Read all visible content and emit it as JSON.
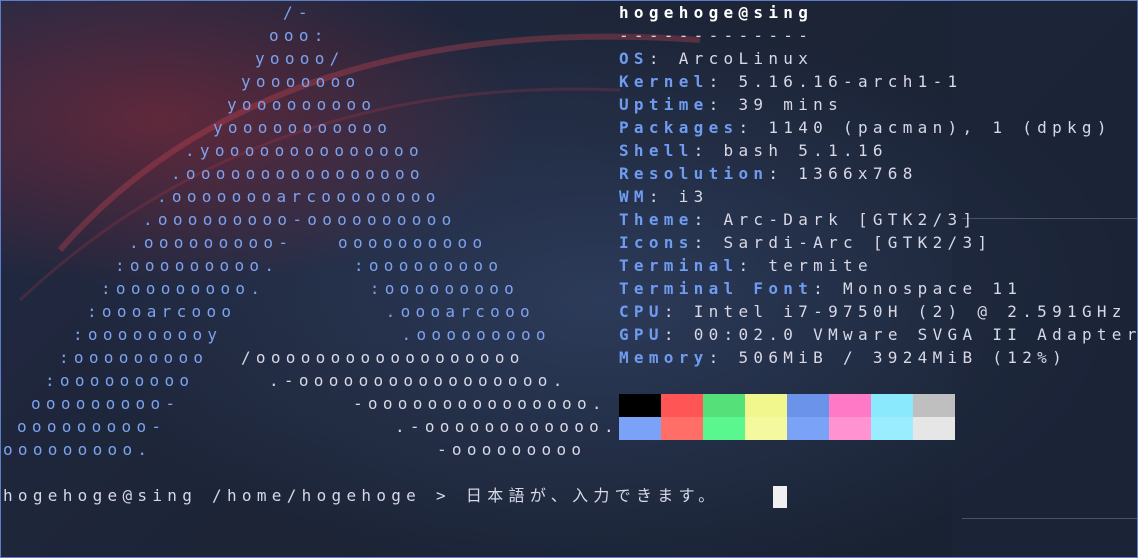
{
  "terminal": {
    "logo_lines": [
      "/-",
      "ooo:",
      "yoooo/",
      "yooooooo",
      "yooooooooo",
      "yooooooooooo",
      ".yoooooooooooooo",
      ".oooooooooooooooo",
      ".oooooooarcoooooooo",
      ".ooooooooo-oooooooooo",
      ".ooooooooo-   oooooooooo",
      ":ooooooooo.     :ooooooooo",
      ":ooooooooo.       :ooooooooo",
      ":oooarcooo          .oooarcooo",
      ":ooooooooy            .ooooooooo",
      ":ooooooooo    ",
      ":ooooooooo       ",
      "ooooooooo-            ",
      "ooooooooo-                  ",
      "ooooooooo.                       "
    ],
    "logo_white_parts": [
      "/oooooooooooooooooo",
      ".-ooooooooooooooooo.",
      "-ooooooooooooooo.",
      ".-oooooooooooo.",
      "-ooooooooo"
    ],
    "info": {
      "title": "hogehoge@sing",
      "separator": "-------------",
      "rows": [
        {
          "key": "OS",
          "value": "ArcoLinux"
        },
        {
          "key": "Kernel",
          "value": "5.16.16-arch1-1"
        },
        {
          "key": "Uptime",
          "value": "39 mins"
        },
        {
          "key": "Packages",
          "value": "1140 (pacman), 1 (dpkg)"
        },
        {
          "key": "Shell",
          "value": "bash 5.1.16"
        },
        {
          "key": "Resolution",
          "value": "1366x768"
        },
        {
          "key": "WM",
          "value": "i3"
        },
        {
          "key": "Theme",
          "value": "Arc-Dark [GTK2/3]"
        },
        {
          "key": "Icons",
          "value": "Sardi-Arc [GTK2/3]"
        },
        {
          "key": "Terminal",
          "value": "termite"
        },
        {
          "key": "Terminal Font",
          "value": "Monospace 11"
        },
        {
          "key": "CPU",
          "value": "Intel i7-9750H (2) @ 2.591GHz"
        },
        {
          "key": "GPU",
          "value": "00:02.0 VMware SVGA II Adapter"
        },
        {
          "key": "Memory",
          "value": "506MiB / 3924MiB (12%)"
        }
      ]
    },
    "palette": {
      "normal": [
        "#000000",
        "#ff5555",
        "#55e07a",
        "#f1f78c",
        "#6b93ea",
        "#ff79c6",
        "#8be9fd",
        "#bfbfbf"
      ],
      "bright": [
        "#7aa2f7",
        "#ff6e67",
        "#5af78e",
        "#f4f99d",
        "#7aa2f7",
        "#ff92d0",
        "#9aedfe",
        "#e6e6e6"
      ]
    },
    "prompt": "hogehoge@sing /home/hogehoge > 日本語が、入力できます。"
  }
}
